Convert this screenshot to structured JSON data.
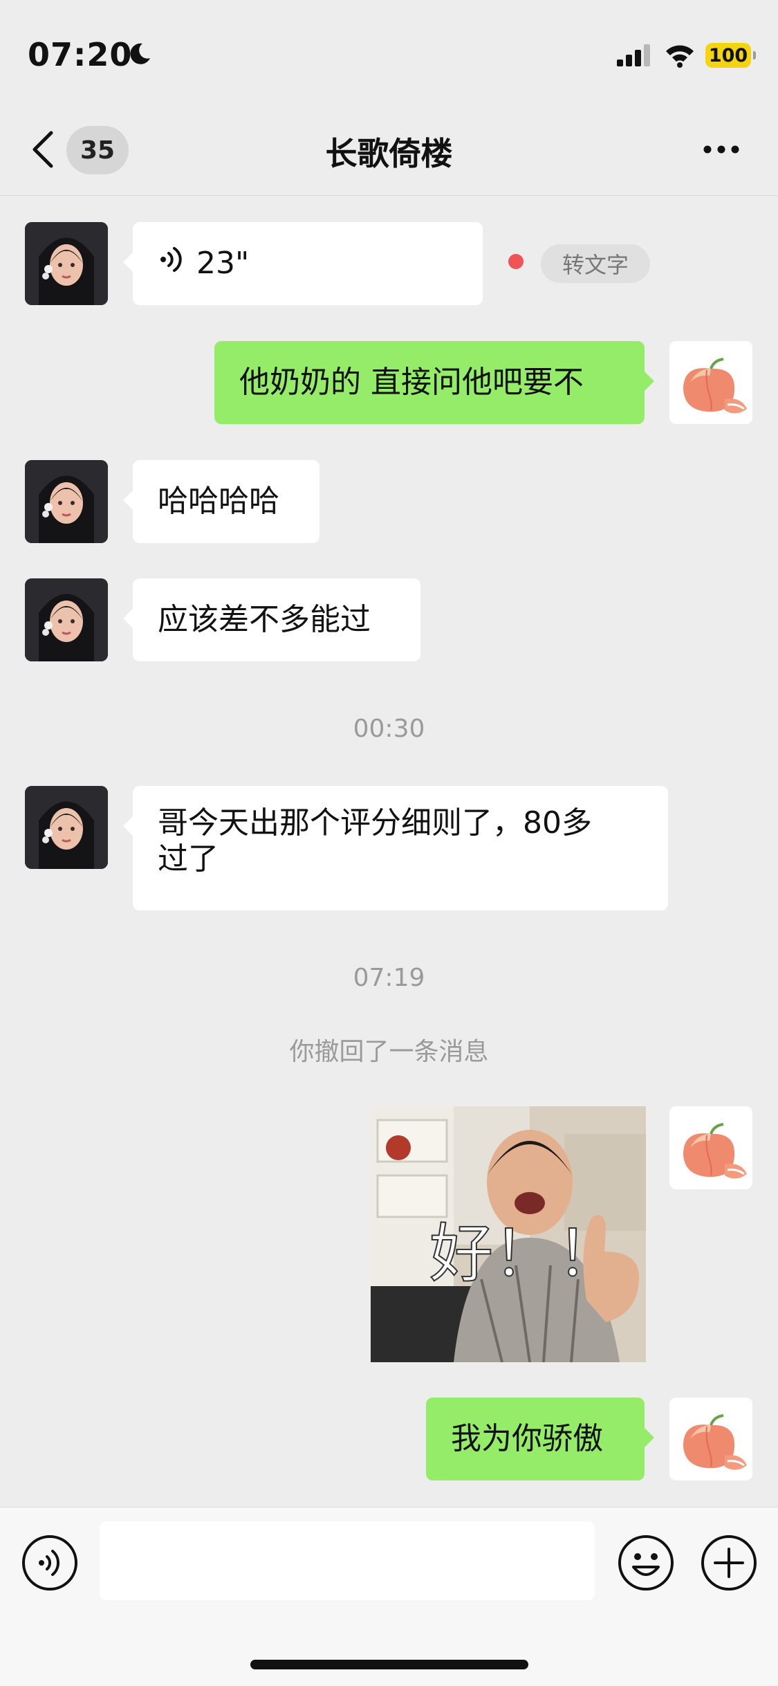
{
  "status_bar": {
    "time": "07:20",
    "battery": "100",
    "icons": [
      "moon-icon",
      "signal-icon",
      "wifi-icon",
      "battery-icon"
    ]
  },
  "nav": {
    "unread_count": "35",
    "title": "长歌倚楼",
    "icons": [
      "back-icon",
      "more-icon"
    ]
  },
  "messages": [
    {
      "type": "voice",
      "side": "in",
      "duration": "23\"",
      "to_text_label": "转文字"
    },
    {
      "type": "text",
      "side": "out",
      "text": "他奶奶的 直接问他吧要不"
    },
    {
      "type": "text",
      "side": "in",
      "text": "哈哈哈哈"
    },
    {
      "type": "text",
      "side": "in",
      "text": "应该差不多能过"
    },
    {
      "type": "time",
      "text": "00:30"
    },
    {
      "type": "text",
      "side": "in",
      "lines": [
        "哥今天出那个评分细则了，80多",
        "过了"
      ]
    },
    {
      "type": "time",
      "text": "07:19"
    },
    {
      "type": "system",
      "text": "你撤回了一条消息"
    },
    {
      "type": "sticker",
      "side": "out",
      "caption": "好！！"
    },
    {
      "type": "text",
      "side": "out",
      "text": "我为你骄傲"
    }
  ],
  "input_bar": {
    "value": "",
    "icons": [
      "voice-toggle-icon",
      "emoji-icon",
      "plus-icon"
    ]
  },
  "colors": {
    "background": "#ededed",
    "outgoing_bubble": "#95ec69",
    "incoming_bubble": "#ffffff",
    "battery": "#f4d40f",
    "unread_dot": "#f05555"
  }
}
